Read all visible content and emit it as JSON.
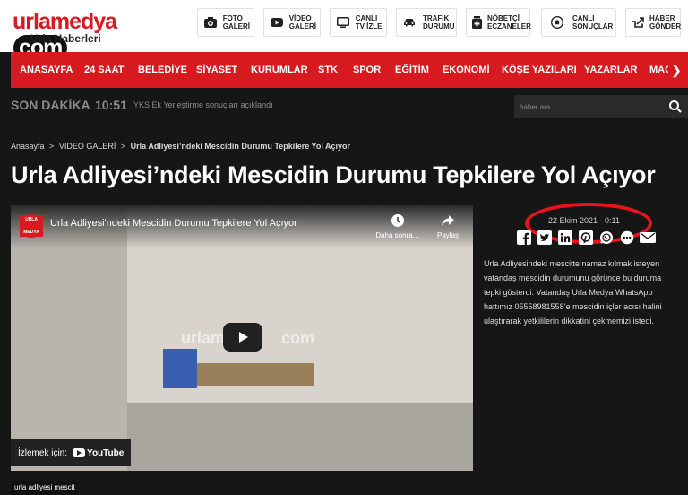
{
  "brand": {
    "logo_main": "urlamedya",
    "logo_com": "com",
    "logo_sub": "Urla Haberleri"
  },
  "header_buttons": [
    {
      "label1": "FOTO",
      "label2": "GALERİ",
      "icon": "camera-icon"
    },
    {
      "label1": "VİDEO",
      "label2": "GALERİ",
      "icon": "youtube-icon"
    },
    {
      "label1": "CANLI",
      "label2": "TV İZLE",
      "icon": "tv-icon"
    },
    {
      "label1": "TRAFİK",
      "label2": "DURUMU",
      "icon": "car-icon"
    },
    {
      "label1": "NÖBETÇİ",
      "label2": "ECZANELER",
      "icon": "pharmacy-icon"
    },
    {
      "label1": "CANLI",
      "label2": "SONUÇLAR",
      "icon": "soccer-ball-icon"
    },
    {
      "label1": "HABER",
      "label2": "GÖNDER",
      "icon": "send-icon"
    }
  ],
  "nav": [
    "ANASAYFA",
    "24 SAAT",
    "BELEDİYE",
    "SİYASET",
    "KURUMLAR",
    "STK",
    "SPOR",
    "EĞİTİM",
    "EKONOMİ",
    "KÖŞE YAZILARI",
    "YAZARLAR",
    "MAGA"
  ],
  "nav_arrow": "❯",
  "breaking": {
    "label": "SON DAKİKA",
    "time": "10:51",
    "text": "YKS Ek Yerleştirme sonuçları açıklandı"
  },
  "search": {
    "placeholder": "haber ara..."
  },
  "breadcrumb": {
    "home": "Anasayfa",
    "section": "VIDEO GALERİ",
    "current": "Urla Adliyesi’ndeki Mescidin Durumu Tepkilere Yol Açıyor",
    "sep": ">"
  },
  "article": {
    "title": "Urla Adliyesi’ndeki Mescidin Durumu Tepkilere Yol Açıyor",
    "date": "22 Ekim 2021 - 0:11",
    "description": "Urla Adliyesindeki mescitte namaz kılmak isteyen vatandaş mescidin durumunu görünce bu duruma tepki gösterdi. Vatandaş Urla Medya WhatsApp hattımız 05558981558’e mescidin içler acısı halini ulaştırarak yetkililerin dikkatini çekmemizi istedi.",
    "tag": "urla adliyesi mescit"
  },
  "video": {
    "title": "Urla Adliyesi'ndeki Mescidin Durumu Tepkilere Yol Açıyor",
    "avatar_line1": "URLA",
    "avatar_line2": "MEDYA",
    "watch_later": "Daha sonra…",
    "share": "Paylaş",
    "watermark_text": "urlamedya",
    "watermark_com": "com",
    "watch_on": "İzlemek için:",
    "youtube": "YouTube"
  },
  "share_icons": [
    "facebook-icon",
    "twitter-icon",
    "linkedin-icon",
    "pinterest-icon",
    "whatsapp-icon",
    "more-icon",
    "email-icon"
  ],
  "colors": {
    "brand_red": "#d71920",
    "annotation_red": "#e8141c",
    "background": "#161616"
  }
}
